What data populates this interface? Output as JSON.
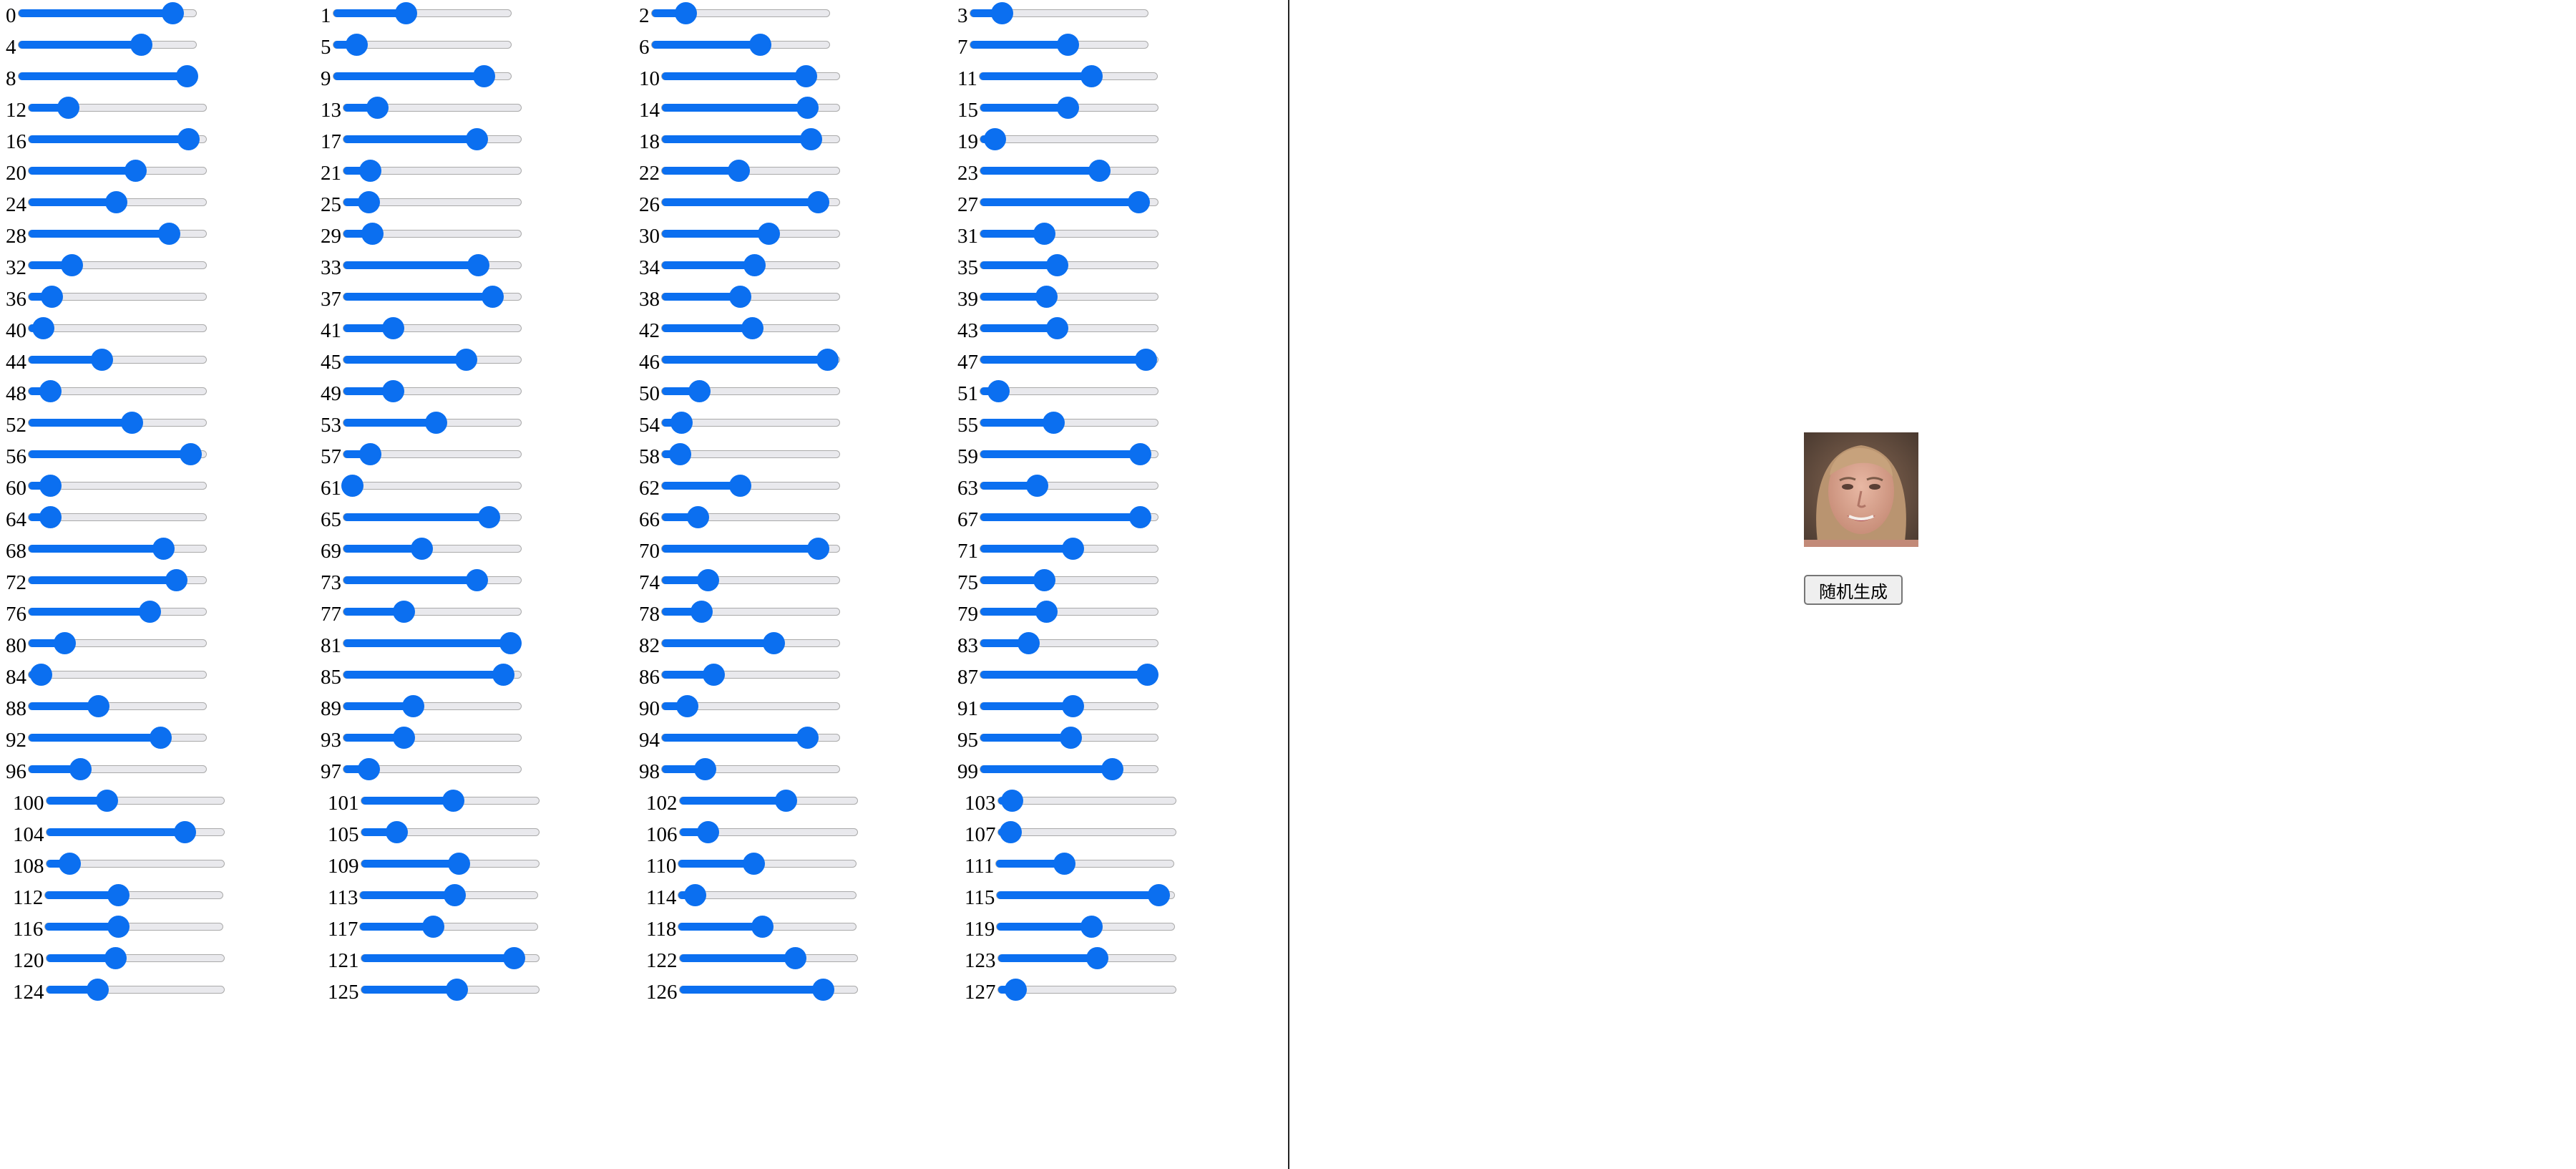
{
  "sliders": [
    {
      "label": "0",
      "value": 0.87
    },
    {
      "label": "1",
      "value": 0.41
    },
    {
      "label": "2",
      "value": 0.19
    },
    {
      "label": "3",
      "value": 0.18
    },
    {
      "label": "4",
      "value": 0.69
    },
    {
      "label": "5",
      "value": 0.13
    },
    {
      "label": "6",
      "value": 0.61
    },
    {
      "label": "7",
      "value": 0.55
    },
    {
      "label": "8",
      "value": 0.95
    },
    {
      "label": "9",
      "value": 0.85
    },
    {
      "label": "10",
      "value": 0.81
    },
    {
      "label": "11",
      "value": 0.63
    },
    {
      "label": "12",
      "value": 0.22
    },
    {
      "label": "13",
      "value": 0.19
    },
    {
      "label": "14",
      "value": 0.82
    },
    {
      "label": "15",
      "value": 0.49
    },
    {
      "label": "16",
      "value": 0.9
    },
    {
      "label": "17",
      "value": 0.75
    },
    {
      "label": "18",
      "value": 0.84
    },
    {
      "label": "19",
      "value": 0.08
    },
    {
      "label": "20",
      "value": 0.6
    },
    {
      "label": "21",
      "value": 0.15
    },
    {
      "label": "22",
      "value": 0.43
    },
    {
      "label": "23",
      "value": 0.67
    },
    {
      "label": "24",
      "value": 0.49
    },
    {
      "label": "25",
      "value": 0.14
    },
    {
      "label": "26",
      "value": 0.88
    },
    {
      "label": "27",
      "value": 0.89
    },
    {
      "label": "28",
      "value": 0.79
    },
    {
      "label": "29",
      "value": 0.16
    },
    {
      "label": "30",
      "value": 0.6
    },
    {
      "label": "31",
      "value": 0.36
    },
    {
      "label": "32",
      "value": 0.24
    },
    {
      "label": "33",
      "value": 0.76
    },
    {
      "label": "34",
      "value": 0.52
    },
    {
      "label": "35",
      "value": 0.43
    },
    {
      "label": "36",
      "value": 0.13
    },
    {
      "label": "37",
      "value": 0.84
    },
    {
      "label": "38",
      "value": 0.44
    },
    {
      "label": "39",
      "value": 0.37
    },
    {
      "label": "40",
      "value": 0.08
    },
    {
      "label": "41",
      "value": 0.28
    },
    {
      "label": "42",
      "value": 0.51
    },
    {
      "label": "43",
      "value": 0.43
    },
    {
      "label": "44",
      "value": 0.41
    },
    {
      "label": "45",
      "value": 0.69
    },
    {
      "label": "46",
      "value": 0.93
    },
    {
      "label": "47",
      "value": 0.93
    },
    {
      "label": "48",
      "value": 0.12
    },
    {
      "label": "49",
      "value": 0.28
    },
    {
      "label": "50",
      "value": 0.21
    },
    {
      "label": "51",
      "value": 0.1
    },
    {
      "label": "52",
      "value": 0.58
    },
    {
      "label": "53",
      "value": 0.52
    },
    {
      "label": "54",
      "value": 0.11
    },
    {
      "label": "55",
      "value": 0.41
    },
    {
      "label": "56",
      "value": 0.91
    },
    {
      "label": "57",
      "value": 0.15
    },
    {
      "label": "58",
      "value": 0.1
    },
    {
      "label": "59",
      "value": 0.9
    },
    {
      "label": "60",
      "value": 0.12
    },
    {
      "label": "61",
      "value": 0.05
    },
    {
      "label": "62",
      "value": 0.44
    },
    {
      "label": "63",
      "value": 0.32
    },
    {
      "label": "64",
      "value": 0.12
    },
    {
      "label": "65",
      "value": 0.82
    },
    {
      "label": "66",
      "value": 0.2
    },
    {
      "label": "67",
      "value": 0.9
    },
    {
      "label": "68",
      "value": 0.76
    },
    {
      "label": "69",
      "value": 0.44
    },
    {
      "label": "70",
      "value": 0.88
    },
    {
      "label": "71",
      "value": 0.52
    },
    {
      "label": "72",
      "value": 0.83
    },
    {
      "label": "73",
      "value": 0.75
    },
    {
      "label": "74",
      "value": 0.26
    },
    {
      "label": "75",
      "value": 0.36
    },
    {
      "label": "76",
      "value": 0.68
    },
    {
      "label": "77",
      "value": 0.34
    },
    {
      "label": "78",
      "value": 0.22
    },
    {
      "label": "79",
      "value": 0.37
    },
    {
      "label": "80",
      "value": 0.2
    },
    {
      "label": "81",
      "value": 0.94
    },
    {
      "label": "82",
      "value": 0.63
    },
    {
      "label": "83",
      "value": 0.27
    },
    {
      "label": "84",
      "value": 0.07
    },
    {
      "label": "85",
      "value": 0.9
    },
    {
      "label": "86",
      "value": 0.29
    },
    {
      "label": "87",
      "value": 0.94
    },
    {
      "label": "88",
      "value": 0.39
    },
    {
      "label": "89",
      "value": 0.39
    },
    {
      "label": "90",
      "value": 0.14
    },
    {
      "label": "91",
      "value": 0.52
    },
    {
      "label": "92",
      "value": 0.74
    },
    {
      "label": "93",
      "value": 0.34
    },
    {
      "label": "94",
      "value": 0.82
    },
    {
      "label": "95",
      "value": 0.51
    },
    {
      "label": "96",
      "value": 0.29
    },
    {
      "label": "97",
      "value": 0.14
    },
    {
      "label": "98",
      "value": 0.24
    },
    {
      "label": "99",
      "value": 0.74
    },
    {
      "label": "100",
      "value": 0.34
    },
    {
      "label": "101",
      "value": 0.52
    },
    {
      "label": "102",
      "value": 0.6
    },
    {
      "label": "103",
      "value": 0.08
    },
    {
      "label": "104",
      "value": 0.78
    },
    {
      "label": "105",
      "value": 0.2
    },
    {
      "label": "106",
      "value": 0.16
    },
    {
      "label": "107",
      "value": 0.07
    },
    {
      "label": "108",
      "value": 0.13
    },
    {
      "label": "109",
      "value": 0.55
    },
    {
      "label": "110",
      "value": 0.42
    },
    {
      "label": "111",
      "value": 0.38
    },
    {
      "label": "112",
      "value": 0.41
    },
    {
      "label": "113",
      "value": 0.53
    },
    {
      "label": "114",
      "value": 0.09
    },
    {
      "label": "115",
      "value": 0.91
    },
    {
      "label": "116",
      "value": 0.41
    },
    {
      "label": "117",
      "value": 0.41
    },
    {
      "label": "118",
      "value": 0.47
    },
    {
      "label": "119",
      "value": 0.53
    },
    {
      "label": "120",
      "value": 0.39
    },
    {
      "label": "121",
      "value": 0.86
    },
    {
      "label": "122",
      "value": 0.65
    },
    {
      "label": "123",
      "value": 0.56
    },
    {
      "label": "124",
      "value": 0.29
    },
    {
      "label": "125",
      "value": 0.54
    },
    {
      "label": "126",
      "value": 0.81
    },
    {
      "label": "127",
      "value": 0.1
    }
  ],
  "generate_button_label": "随机生成",
  "colors": {
    "accent": "#0b6ff0",
    "track": "#e9e9ed",
    "divider": "#222222"
  },
  "image_description_icon": "generated-face-image"
}
